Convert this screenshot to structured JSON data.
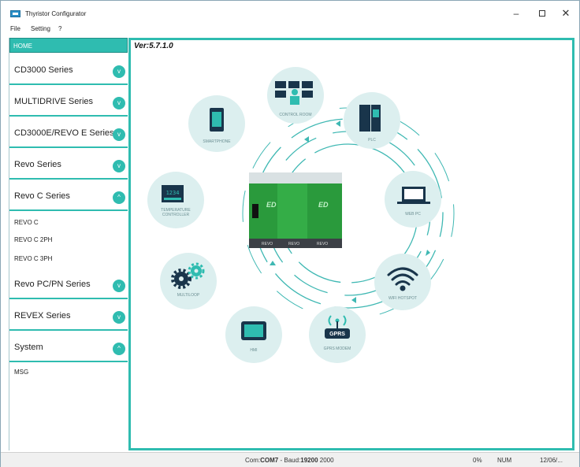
{
  "window": {
    "title": "Thyristor Configurator"
  },
  "menu": {
    "file": "File",
    "setting": "Setting",
    "help": "?"
  },
  "sidebar": {
    "home": "HOME",
    "series": [
      {
        "label": "CD3000 Series",
        "expanded": false
      },
      {
        "label": "MULTIDRIVE Series",
        "expanded": false
      },
      {
        "label": "CD3000E/REVO E Series",
        "expanded": false
      },
      {
        "label": "Revo Series",
        "expanded": false
      },
      {
        "label": "Revo C Series",
        "expanded": true,
        "items": [
          "REVO C",
          "REVO C 2PH",
          "REVO C 3PH"
        ]
      },
      {
        "label": "Revo PC/PN Series",
        "expanded": false
      },
      {
        "label": "REVEX Series",
        "expanded": false
      },
      {
        "label": "System",
        "expanded": true,
        "items": [
          "MSG"
        ]
      }
    ]
  },
  "content": {
    "version": "Ver:5.7.1.0",
    "diagram": {
      "nodes": [
        {
          "label": "CONTROL ROOM",
          "icon": "control-room-icon"
        },
        {
          "label": "PLC",
          "icon": "plc-icon"
        },
        {
          "label": "WEB PC",
          "icon": "laptop-icon"
        },
        {
          "label": "WIFI HOTSPOT",
          "icon": "wifi-icon"
        },
        {
          "label": "GPRS MODEM",
          "icon": "gprs-icon",
          "badge": "GPRS"
        },
        {
          "label": "HMI",
          "icon": "tablet-icon"
        },
        {
          "label": "MULTILOOP",
          "icon": "gears-icon"
        },
        {
          "label": "TEMPERATURE CONTROLLER",
          "icon": "temperature-controller-icon",
          "display": "1234"
        },
        {
          "label": "SMARTPHONE",
          "icon": "smartphone-icon"
        }
      ],
      "device_labels": [
        "REVO",
        "REVO",
        "REVO"
      ],
      "device_logo": "ED"
    }
  },
  "status": {
    "com_prefix": "Com:",
    "com_port": "COM7",
    "baud_prefix": " - Baud:",
    "baud": "19200",
    "baud_suffix": " 2000",
    "percent": "0%",
    "num": "NUM",
    "date": "12/06/..."
  },
  "colors": {
    "accent": "#2fbcb0",
    "icon_dark": "#19354b",
    "circle_bg": "#dcefef"
  }
}
